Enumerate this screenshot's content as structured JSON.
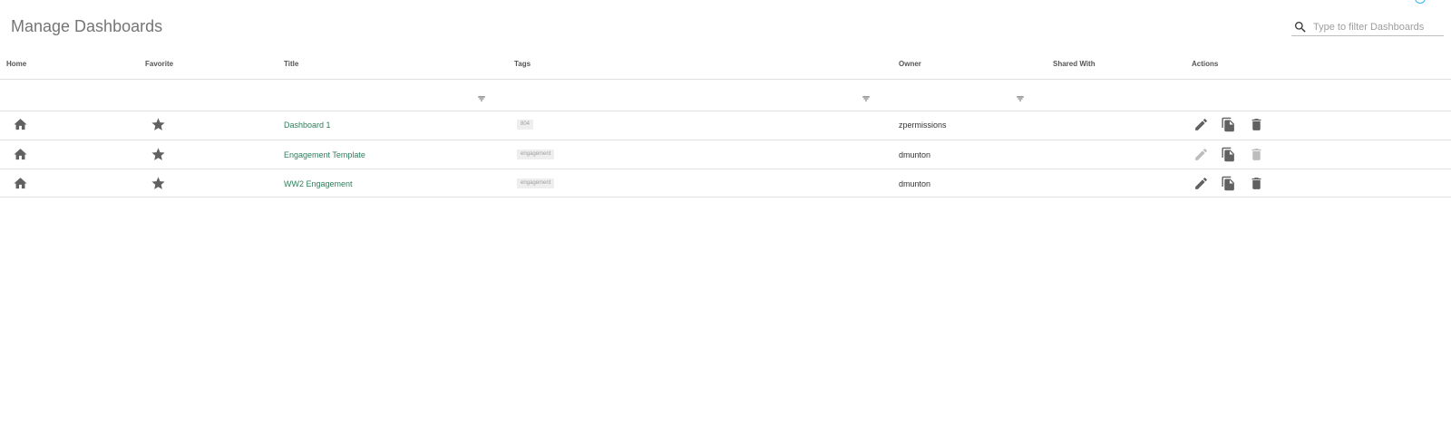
{
  "page": {
    "title": "Manage Dashboards"
  },
  "search": {
    "placeholder": "Type to filter Dashboards",
    "value": ""
  },
  "table": {
    "columns": {
      "home": "Home",
      "favorite": "Favorite",
      "title": "Title",
      "tags": "Tags",
      "owner": "Owner",
      "shared_with": "Shared With",
      "actions": "Actions"
    },
    "rows": [
      {
        "title": "Dashboard 1",
        "tag": "804",
        "owner": "zpermissions",
        "edit_enabled": true,
        "copy_enabled": true,
        "delete_enabled": true
      },
      {
        "title": "Engagement Template",
        "tag": "engagement",
        "owner": "dmunton",
        "edit_enabled": false,
        "copy_enabled": true,
        "delete_enabled": false
      },
      {
        "title": "WW2 Engagement",
        "tag": "engagement",
        "owner": "dmunton",
        "edit_enabled": true,
        "copy_enabled": true,
        "delete_enabled": true
      }
    ]
  },
  "colors": {
    "link": "#2e7d5b",
    "icon": "#616161",
    "icon_disabled": "#bdbdbd",
    "accent": "#29b6f6"
  },
  "icons": [
    "search-icon",
    "filter-icon",
    "home-icon",
    "star-icon",
    "edit-icon",
    "copy-icon",
    "delete-icon"
  ]
}
